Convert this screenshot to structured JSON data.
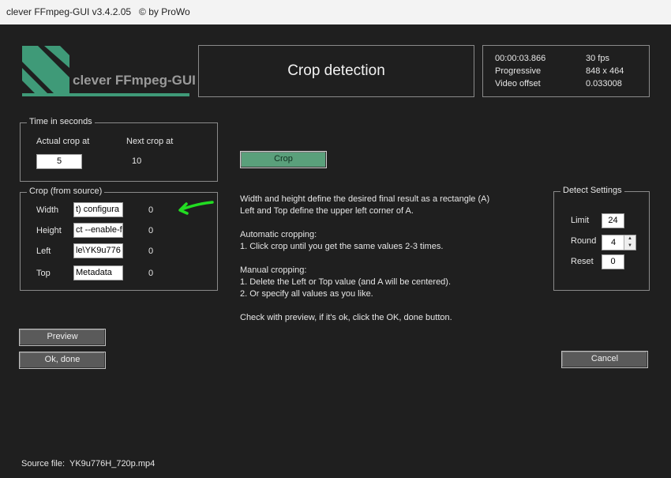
{
  "window": {
    "title": "clever FFmpeg-GUI v3.4.2.05   © by ProWo"
  },
  "logo": {
    "text": "clever FFmpeg-GUI"
  },
  "header": {
    "title": "Crop detection"
  },
  "video_info": {
    "time": "00:00:03.866",
    "fps": "30 fps",
    "scan": "Progressive",
    "resolution": "848 x 464",
    "offset_label": "Video offset",
    "offset_value": "0.033008"
  },
  "time_group": {
    "legend": "Time in seconds",
    "actual_label": "Actual crop at",
    "next_label": "Next crop at",
    "actual_value": "5",
    "next_value": "10"
  },
  "crop_group": {
    "legend": "Crop (from source)",
    "rows": [
      {
        "label": "Width",
        "field": "t)  configura",
        "value": "0"
      },
      {
        "label": "Height",
        "field": "ct --enable-fo",
        "value": "0"
      },
      {
        "label": "Left",
        "field": "le\\YK9u776",
        "value": "0"
      },
      {
        "label": "Top",
        "field": "Metadata",
        "value": "0"
      }
    ]
  },
  "buttons": {
    "crop": "Crop",
    "preview": "Preview",
    "ok_done": "Ok, done",
    "cancel": "Cancel"
  },
  "instructions": {
    "line1": "Width and height define the desired final result as a rectangle (A)",
    "line2": "Left and Top define the upper left corner of A.",
    "auto_title": "Automatic cropping:",
    "auto_1": "1. Click crop until you get the same values 2-3 times.",
    "manual_title": "Manual cropping:",
    "manual_1": "1. Delete the Left or Top value (and A will be centered).",
    "manual_2": "2. Or specify all values as you like.",
    "check": "Check with preview, if it's ok, click the OK, done button."
  },
  "detect_settings": {
    "legend": "Detect Settings",
    "limit_label": "Limit",
    "limit_value": "24",
    "round_label": "Round",
    "round_value": "4",
    "reset_label": "Reset",
    "reset_value": "0"
  },
  "status": {
    "source_label": "Source file:",
    "source_value": "YK9u776H_720p.mp4"
  },
  "colors": {
    "accent_green": "#5aa07b",
    "annotation_arrow": "#22dd22"
  }
}
